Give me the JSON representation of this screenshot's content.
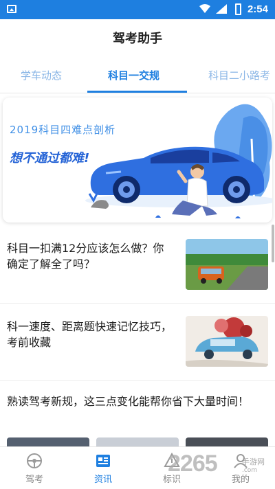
{
  "status_bar": {
    "time": "2:54"
  },
  "header": {
    "title": "驾考助手"
  },
  "tabs": [
    {
      "label": "学车动态",
      "active": false
    },
    {
      "label": "科目一交规",
      "active": true
    },
    {
      "label": "科目二小路考",
      "active": false
    }
  ],
  "banner": {
    "line1": "2019科目四难点剖析",
    "line2": "想不通过都难!"
  },
  "articles": [
    {
      "title": "科目一扣满12分应该怎么做？你确定了解全了吗？"
    },
    {
      "title": "科一速度、距离题快速记忆技巧，考前收藏"
    },
    {
      "title": "熟读驾考新规，这三点变化能帮你省下大量时间！"
    }
  ],
  "bottom_nav": [
    {
      "label": "驾考",
      "icon": "steering-wheel-icon",
      "active": false
    },
    {
      "label": "资讯",
      "icon": "news-icon",
      "active": true
    },
    {
      "label": "标识",
      "icon": "sign-icon",
      "active": false
    },
    {
      "label": "我的",
      "icon": "profile-icon",
      "active": false
    }
  ],
  "watermark": {
    "number": "2265",
    "site": "手游网",
    "url": ".com"
  },
  "colors": {
    "accent": "#1e7fe0",
    "tab_inactive": "#8ab6e6"
  }
}
